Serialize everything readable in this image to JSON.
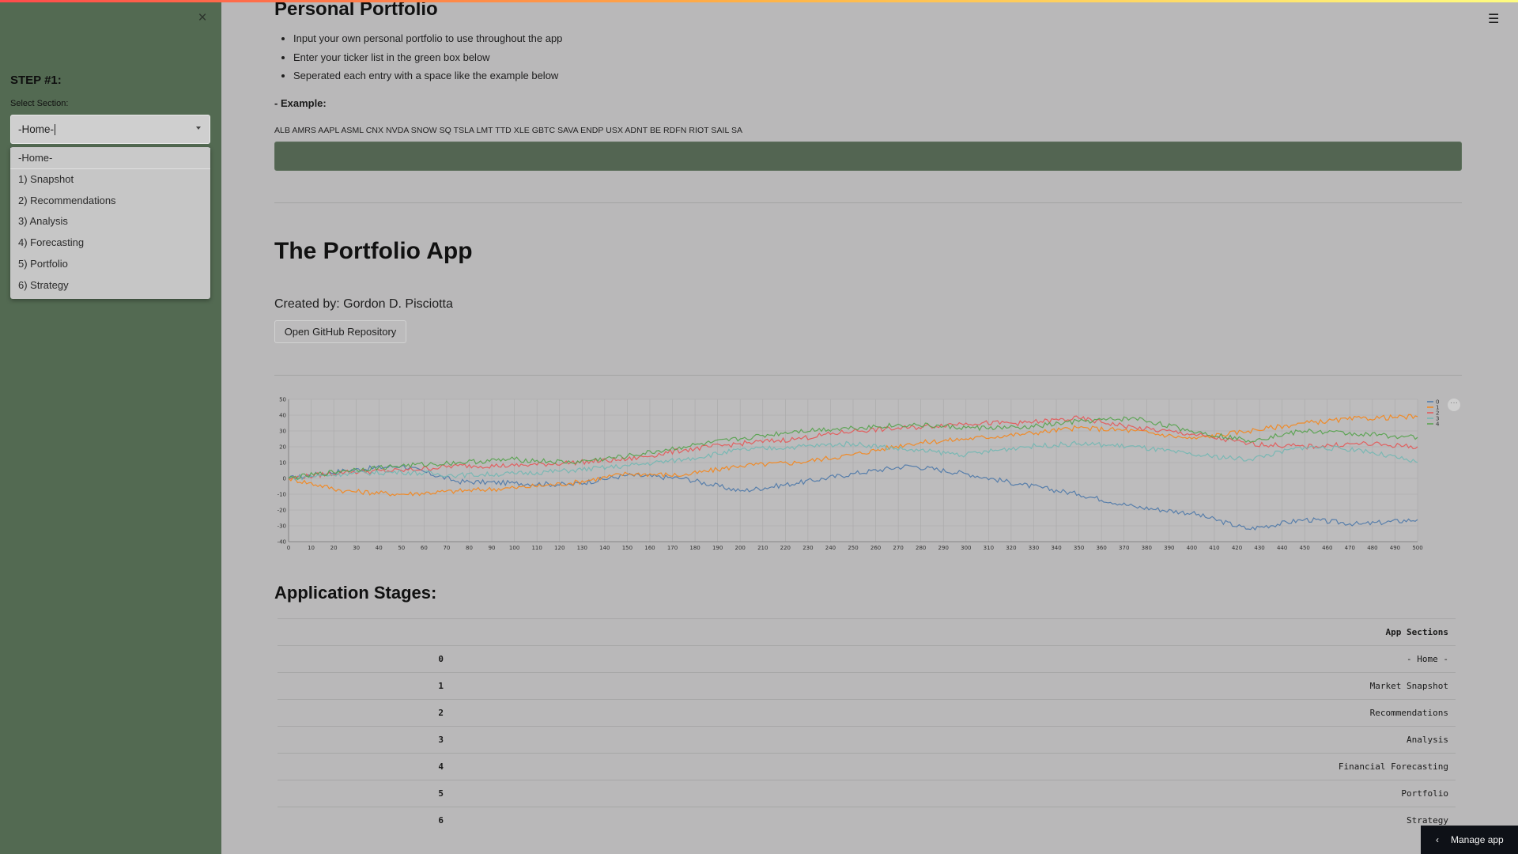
{
  "sidebar": {
    "close_icon": "×",
    "step_title": "STEP #1:",
    "select_label": "Select Section:",
    "select_value": "-Home-",
    "options": [
      "-Home-",
      "1) Snapshot",
      "2) Recommendations",
      "3) Analysis",
      "4) Forecasting",
      "5) Portfolio",
      "6) Strategy"
    ]
  },
  "main": {
    "portfolio_title": "Personal Portfolio",
    "bullets": [
      "Input your own personal portfolio to use throughout the app",
      "Enter your ticker list in the green box below",
      "Seperated each entry with a space like the example below"
    ],
    "example_label": "- Example:",
    "example_text": "ALB AMRS AAPL ASML CNX NVDA SNOW SQ TSLA LMT TTD XLE GBTC SAVA ENDP USX ADNT BE RDFN RIOT SAIL SA",
    "ticker_input_value": "",
    "app_title": "The Portfolio App",
    "created_by": "Created by: Gordon D. Pisciotta",
    "github_button": "Open GitHub Repository",
    "stages_title": "Application Stages:",
    "table": {
      "header": "App Sections",
      "rows": [
        {
          "index": "0",
          "value": "- Home -"
        },
        {
          "index": "1",
          "value": "Market Snapshot"
        },
        {
          "index": "2",
          "value": "Recommendations"
        },
        {
          "index": "3",
          "value": "Analysis"
        },
        {
          "index": "4",
          "value": "Financial Forecasting"
        },
        {
          "index": "5",
          "value": "Portfolio"
        },
        {
          "index": "6",
          "value": "Strategy"
        }
      ]
    }
  },
  "header": {
    "menu_icon": "hamburger-icon"
  },
  "footer": {
    "manage_app_label": "Manage app",
    "chevron_icon": "chevron-left-icon"
  },
  "chart_data": {
    "type": "line",
    "title": "",
    "xlabel": "",
    "ylabel": "",
    "xlim": [
      0,
      500
    ],
    "ylim": [
      -40,
      50
    ],
    "x_ticks": [
      0,
      10,
      20,
      30,
      40,
      50,
      60,
      70,
      80,
      90,
      100,
      110,
      120,
      130,
      140,
      150,
      160,
      170,
      180,
      190,
      200,
      210,
      220,
      230,
      240,
      250,
      260,
      270,
      280,
      290,
      300,
      310,
      320,
      330,
      340,
      350,
      360,
      370,
      380,
      390,
      400,
      410,
      420,
      430,
      440,
      450,
      460,
      470,
      480,
      490,
      500
    ],
    "y_ticks": [
      -40,
      -30,
      -20,
      -10,
      0,
      10,
      20,
      30,
      40,
      50
    ],
    "grid": true,
    "legend": "top-right",
    "x": [
      0,
      25,
      50,
      75,
      100,
      125,
      150,
      175,
      200,
      225,
      250,
      275,
      300,
      325,
      350,
      375,
      400,
      425,
      450,
      475,
      500
    ],
    "series": [
      {
        "name": "0",
        "color": "#4c78a8",
        "values": [
          0,
          5,
          8,
          -2,
          -3,
          -4,
          2,
          0,
          -8,
          -3,
          3,
          8,
          3,
          -4,
          -10,
          -18,
          -22,
          -32,
          -26,
          -29,
          -26
        ]
      },
      {
        "name": "1",
        "color": "#f58518",
        "values": [
          0,
          -8,
          -10,
          -8,
          -6,
          -3,
          3,
          2,
          8,
          10,
          15,
          22,
          25,
          28,
          32,
          30,
          25,
          30,
          35,
          38,
          39
        ]
      },
      {
        "name": "2",
        "color": "#e45756",
        "values": [
          0,
          4,
          5,
          8,
          8,
          10,
          12,
          18,
          22,
          25,
          30,
          32,
          35,
          35,
          38,
          32,
          28,
          22,
          20,
          22,
          20
        ]
      },
      {
        "name": "3",
        "color": "#72b7b2",
        "values": [
          0,
          3,
          4,
          2,
          3,
          5,
          8,
          12,
          18,
          20,
          22,
          18,
          15,
          20,
          22,
          20,
          15,
          12,
          20,
          18,
          10
        ]
      },
      {
        "name": "4",
        "color": "#54a24b",
        "values": [
          0,
          5,
          8,
          10,
          12,
          10,
          14,
          20,
          25,
          30,
          32,
          34,
          32,
          32,
          36,
          38,
          30,
          24,
          30,
          28,
          26
        ]
      }
    ]
  }
}
